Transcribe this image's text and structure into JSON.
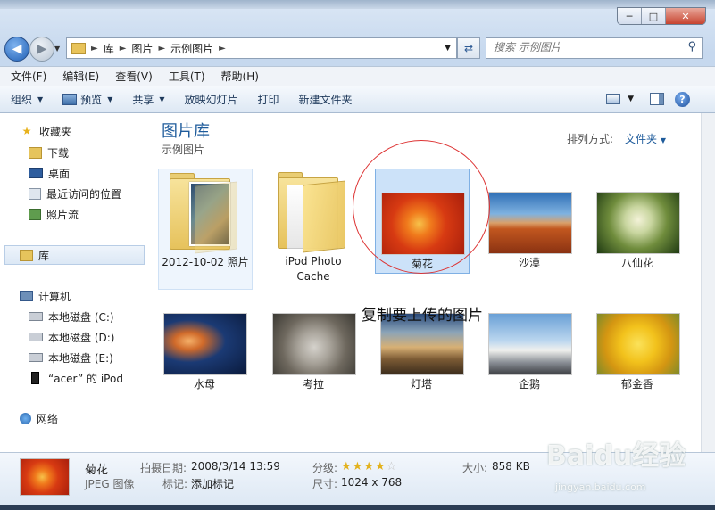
{
  "window": {
    "controls": {
      "minimize": "─",
      "maximize": "□",
      "close": "✕"
    }
  },
  "address": {
    "breadcrumb": [
      "库",
      "图片",
      "示例图片"
    ],
    "search_placeholder": "搜索 示例图片"
  },
  "menu": [
    "文件(F)",
    "编辑(E)",
    "查看(V)",
    "工具(T)",
    "帮助(H)"
  ],
  "toolbar": {
    "organize": "组织",
    "preview": "预览",
    "share": "共享",
    "slideshow": "放映幻灯片",
    "print": "打印",
    "new_folder": "新建文件夹"
  },
  "nav": {
    "favorites": "收藏夹",
    "downloads": "下载",
    "desktop": "桌面",
    "recent": "最近访问的位置",
    "photostream": "照片流",
    "libraries": "库",
    "computer": "计算机",
    "disk_c": "本地磁盘 (C:)",
    "disk_d": "本地磁盘 (D:)",
    "disk_e": "本地磁盘 (E:)",
    "ipod": "“acer” 的 iPod",
    "network": "网络"
  },
  "library": {
    "title": "图片库",
    "subtitle": "示例图片",
    "arrange_label": "排列方式:",
    "arrange_value": "文件夹"
  },
  "items": [
    {
      "name": "2012-10-02 照片"
    },
    {
      "name": "iPod Photo Cache"
    },
    {
      "name": "菊花"
    },
    {
      "name": "沙漠"
    },
    {
      "name": "八仙花"
    },
    {
      "name": "水母"
    },
    {
      "name": "考拉"
    },
    {
      "name": "灯塔"
    },
    {
      "name": "企鹅"
    },
    {
      "name": "郁金香"
    }
  ],
  "annotation": "复制要上传的图片",
  "details": {
    "name": "菊花",
    "type": "JPEG 图像",
    "date_label": "拍摄日期:",
    "date_value": "2008/3/14 13:59",
    "tags_label": "标记:",
    "tags_value": "添加标记",
    "rating_label": "分级:",
    "rating": 4,
    "rating_max": 5,
    "dims_label": "尺寸:",
    "dims_value": "1024 x 768",
    "size_label": "大小:",
    "size_value": "858 KB"
  },
  "watermark": {
    "brand": "Baidu经验",
    "url": "jingyan.baidu.com"
  }
}
